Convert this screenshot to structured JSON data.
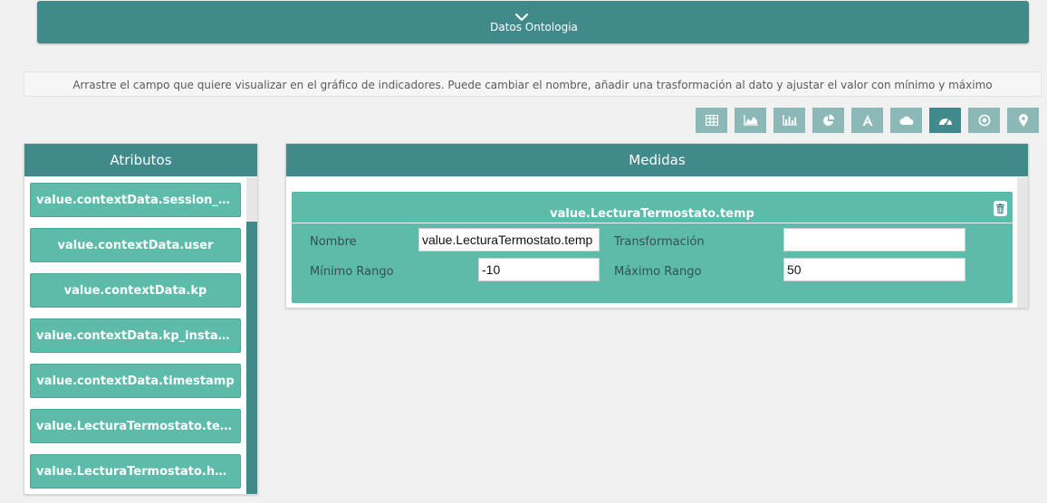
{
  "header": {
    "title": "Datos Ontologia"
  },
  "instructions": "Arrastre el campo que quiere visualizar en el gráfico de indicadores. Puede cambiar el nombre, añadir una trasformación al dato y ajustar el valor con mínimo y máximo",
  "chart_types": [
    {
      "icon": "table-icon",
      "active": false
    },
    {
      "icon": "area-chart-icon",
      "active": false
    },
    {
      "icon": "bar-chart-icon",
      "active": false
    },
    {
      "icon": "pie-chart-icon",
      "active": false
    },
    {
      "icon": "text-icon",
      "active": false
    },
    {
      "icon": "cloud-icon",
      "active": false
    },
    {
      "icon": "gauge-icon",
      "active": true
    },
    {
      "icon": "target-icon",
      "active": false
    },
    {
      "icon": "map-marker-icon",
      "active": false
    }
  ],
  "attributes": {
    "title": "Atributos",
    "items": [
      "value.contextData.session_ke...",
      "value.contextData.user",
      "value.contextData.kp",
      "value.contextData.kp_instanc...",
      "value.contextData.timestamp",
      "value.LecturaTermostato.temp",
      "value.LecturaTermostato.hum"
    ]
  },
  "measures": {
    "title": "Medidas",
    "card": {
      "title": "value.LecturaTermostato.temp",
      "name_label": "Nombre",
      "name_value": "value.LecturaTermostato.temp",
      "transform_label": "Transformación",
      "transform_value": "",
      "min_label": "Mínimo Rango",
      "min_value": "-10",
      "max_label": "Máximo Rango",
      "max_value": "50"
    }
  },
  "colors": {
    "primary": "#408a8c",
    "accent": "#5dbbaa",
    "inactive_button": "#8db8b8"
  }
}
